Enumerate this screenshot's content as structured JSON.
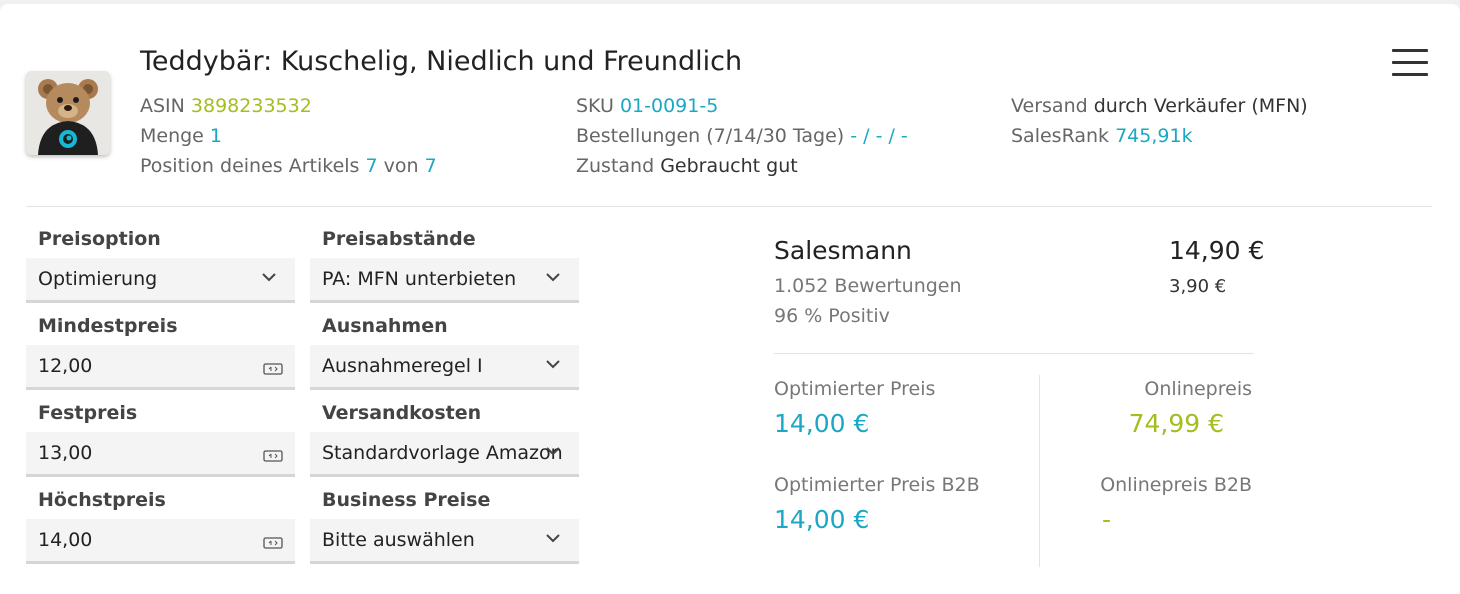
{
  "product": {
    "title": "Teddybär: Kuschelig, Niedlich und Freundlich",
    "image_icon": "teddy-bear-image"
  },
  "info": {
    "asin_label": "ASIN",
    "asin": "3898233532",
    "menge_label": "Menge",
    "menge": "1",
    "position_label": "Position deines Artikels",
    "position_value": "7",
    "position_of": "von",
    "position_total": "7",
    "sku_label": "SKU",
    "sku": "01-0091-5",
    "orders_label": "Bestellungen (7/14/30 Tage)",
    "orders": "- / - / -",
    "condition_label": "Zustand",
    "condition": "Gebraucht gut",
    "shipping_label": "Versand",
    "shipping": "durch Verkäufer (MFN)",
    "salesrank_label": "SalesRank",
    "salesrank": "745,91k"
  },
  "form": {
    "preisoption_label": "Preisoption",
    "preisoption_value": "Optimierung",
    "mindestpreis_label": "Mindestpreis",
    "mindestpreis_value": "12,00",
    "festpreis_label": "Festpreis",
    "festpreis_value": "13,00",
    "hoechstpreis_label": "Höchstpreis",
    "hoechstpreis_value": "14,00",
    "preisabstaende_label": "Preisabstände",
    "preisabstaende_value": "PA: MFN unterbieten",
    "ausnahmen_label": "Ausnahmen",
    "ausnahmen_value": "Ausnahmeregel I",
    "versandkosten_label": "Versandkosten",
    "versandkosten_value": "Standardvorlage Amazon",
    "business_label": "Business Preise",
    "business_value": "Bitte auswählen"
  },
  "seller": {
    "name": "Salesmann",
    "ratings": "1.052 Bewertungen",
    "positive": "96 % Positiv",
    "price": "14,90 €",
    "shipping": "3,90 €"
  },
  "prices": {
    "optimized_label": "Optimierter Preis",
    "optimized_value": "14,00 €",
    "online_label": "Onlinepreis",
    "online_value": "74,99 €",
    "optimized_b2b_label": "Optimierter Preis B2B",
    "optimized_b2b_value": "14,00 €",
    "online_b2b_label": "Onlinepreis B2B",
    "online_b2b_value": "-"
  },
  "colors": {
    "accent_teal": "#1ba8c4",
    "accent_green": "#a3be1e"
  }
}
